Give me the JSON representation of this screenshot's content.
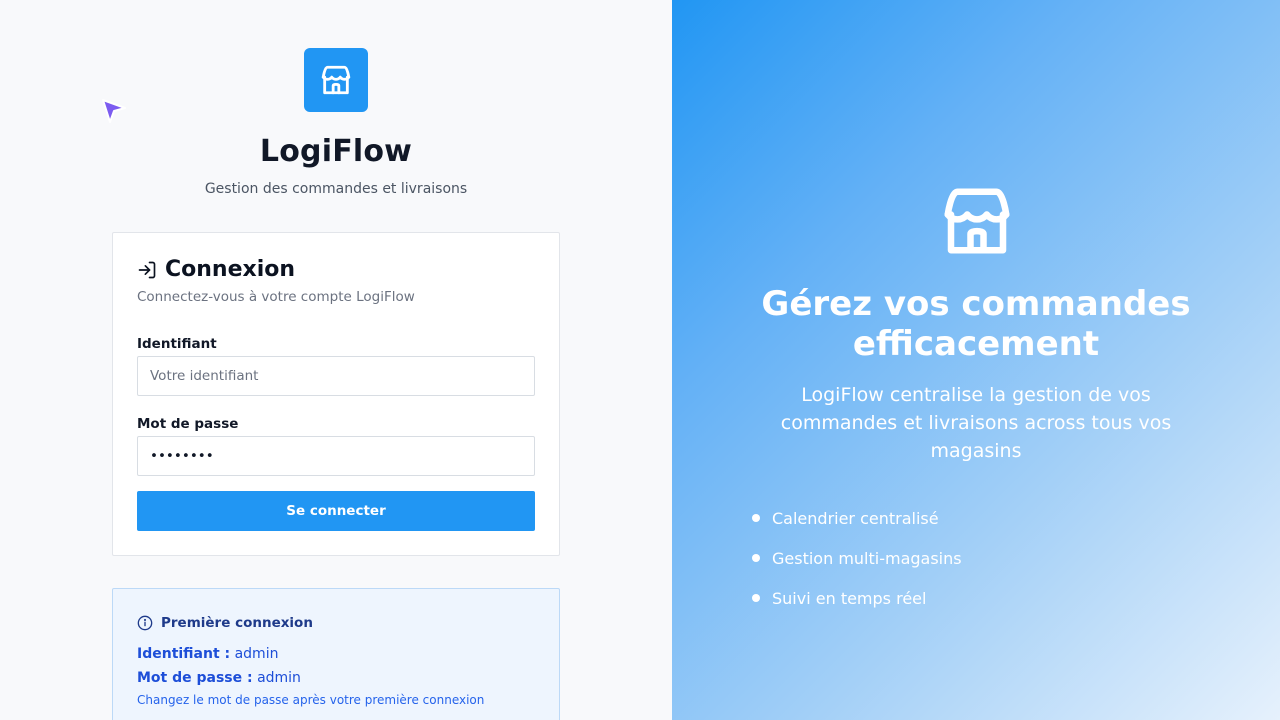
{
  "app": {
    "name": "LogiFlow",
    "tagline": "Gestion des commandes et livraisons"
  },
  "login": {
    "title": "Connexion",
    "subtitle": "Connectez-vous à votre compte LogiFlow",
    "username_label": "Identifiant",
    "username_placeholder": "Votre identifiant",
    "username_value": "",
    "password_label": "Mot de passe",
    "password_value": "••••••••",
    "submit_label": "Se connecter"
  },
  "first_login": {
    "title": "Première connexion",
    "username_key": "Identifiant :",
    "username_value": "admin",
    "password_key": "Mot de passe :",
    "password_value": "admin",
    "note": "Changez le mot de passe après votre première connexion"
  },
  "hero": {
    "title": "Gérez vos commandes efficacement",
    "description": "LogiFlow centralise la gestion de vos commandes et livraisons across tous vos magasins",
    "features": [
      "Calendrier centralisé",
      "Gestion multi-magasins",
      "Suivi en temps réel"
    ]
  },
  "colors": {
    "primary": "#2196f3",
    "info_bg": "#eef5fe",
    "info_text": "#1d4ed8",
    "cursor": "#7c5cf0"
  }
}
